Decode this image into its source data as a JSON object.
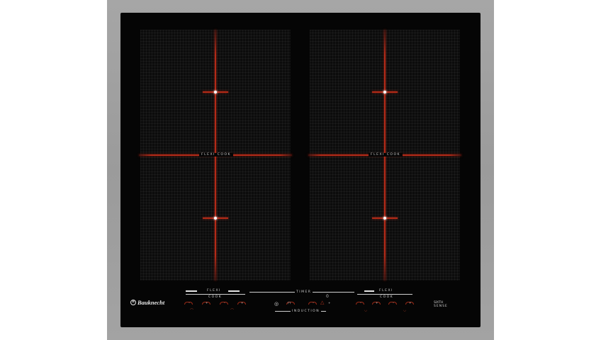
{
  "cooktop": {
    "zones": [
      {
        "id": "left",
        "flexi_label": "FLEXI COOK"
      },
      {
        "id": "right",
        "flexi_label": "FLEXI COOK"
      }
    ]
  },
  "panel": {
    "brand": "Bauknecht",
    "flexi_left": {
      "top": "FLEXI",
      "bottom": "COOK"
    },
    "flexi_right": {
      "top": "FLEXI",
      "bottom": "COOK"
    },
    "timer_label": "TIMER",
    "timer_icon": "0",
    "induction_label": "INDUCTION",
    "sixth_sense": {
      "line1": "SIXTH",
      "line2": "SENSE"
    }
  },
  "colors": {
    "frame": "#a0a0a0",
    "glass": "#050505",
    "heat_line": "#b32a17",
    "indicator": "#ffffff"
  }
}
